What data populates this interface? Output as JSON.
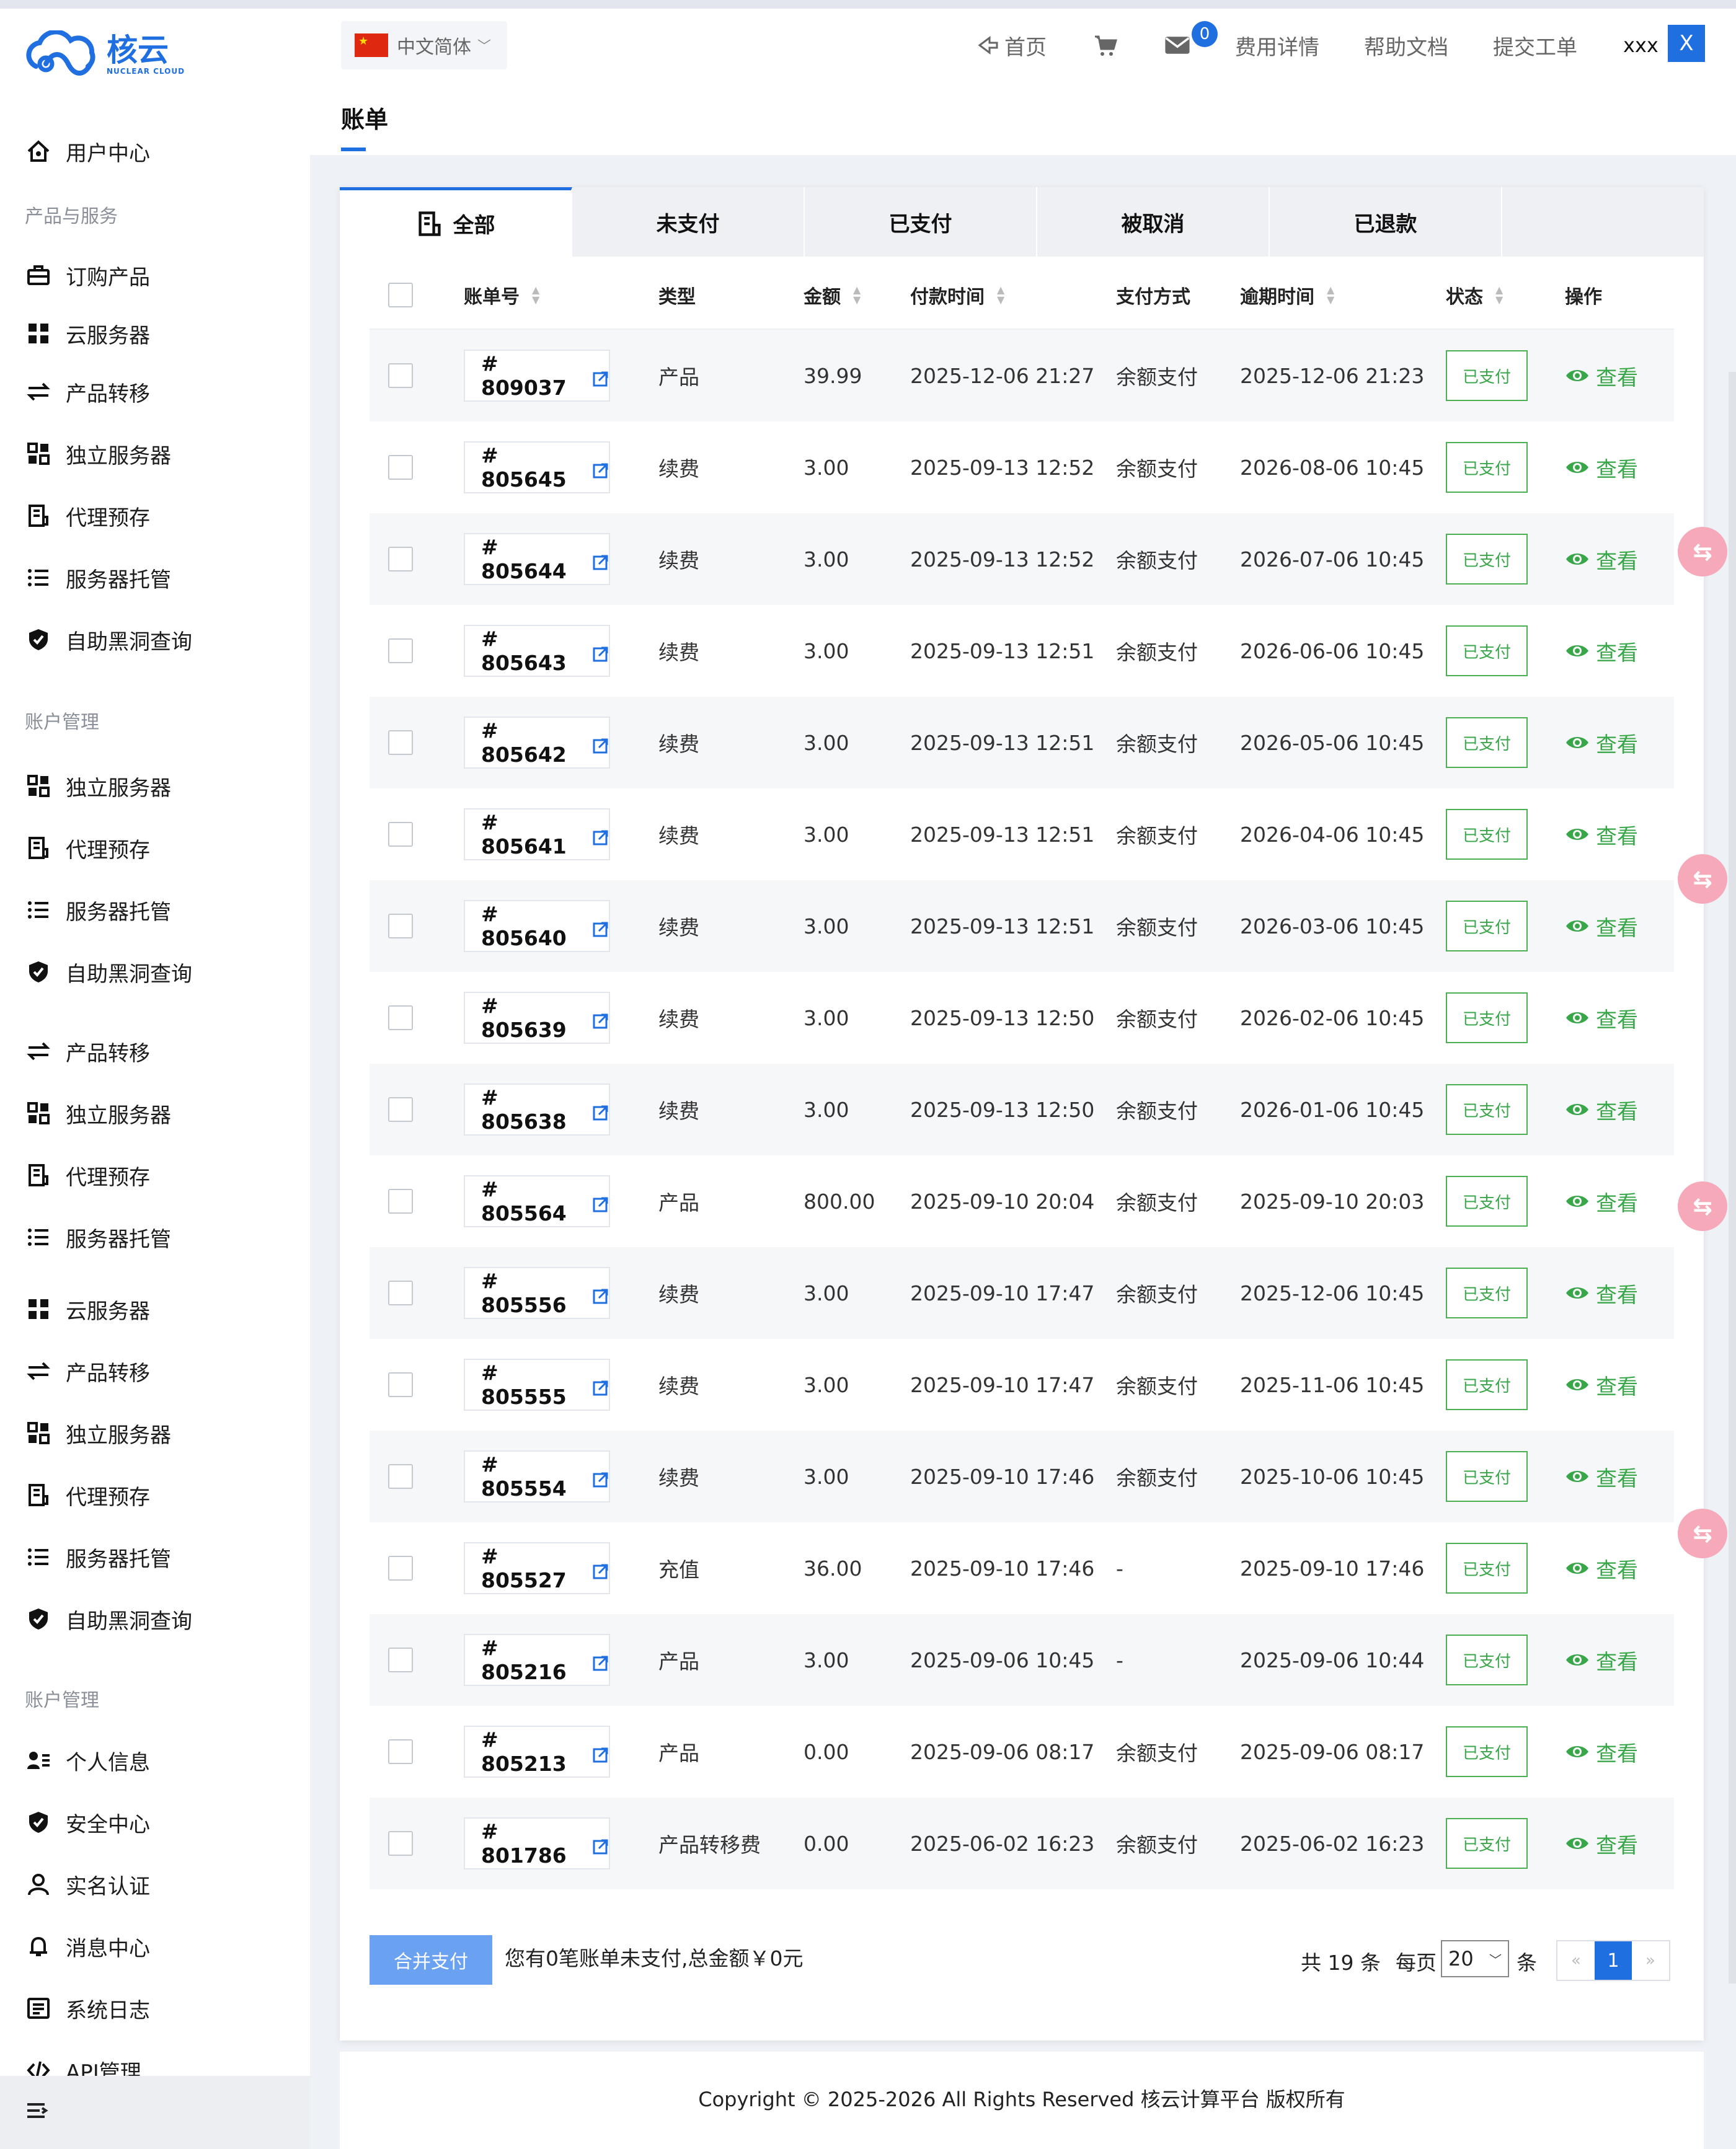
{
  "brand": {
    "name_cn": "核云",
    "name_en": "NUCLEAR CLOUD"
  },
  "header": {
    "language": "中文简体",
    "nav": {
      "home": "首页",
      "billing": "费用详情",
      "docs": "帮助文档",
      "ticket": "提交工单"
    },
    "message_count": "0",
    "username": "xxx",
    "logout_label": "X"
  },
  "sidebar": {
    "items": [
      {
        "label": "用户中心",
        "icon": "home-icon",
        "top": 0
      },
      {
        "section": "产品与服务"
      },
      {
        "label": "订购产品",
        "icon": "briefcase-icon"
      },
      {
        "label": "云服务器",
        "icon": "grid-icon"
      },
      {
        "label": "产品转移",
        "icon": "transfer-icon"
      },
      {
        "label": "独立服务器",
        "icon": "server-grid-icon"
      },
      {
        "label": "代理预存",
        "icon": "document-icon"
      },
      {
        "label": "服务器托管",
        "icon": "list-icon"
      },
      {
        "label": "自助黑洞查询",
        "icon": "shield-icon"
      },
      {
        "section": "账户管理"
      },
      {
        "label": "独立服务器",
        "icon": "server-grid-icon"
      },
      {
        "label": "代理预存",
        "icon": "document-icon"
      },
      {
        "label": "服务器托管",
        "icon": "list-icon"
      },
      {
        "label": "自助黑洞查询",
        "icon": "shield-icon"
      },
      {
        "label": "产品转移",
        "icon": "transfer-icon"
      },
      {
        "label": "独立服务器",
        "icon": "server-grid-icon"
      },
      {
        "label": "代理预存",
        "icon": "document-icon"
      },
      {
        "label": "服务器托管",
        "icon": "list-icon"
      },
      {
        "label": "云服务器",
        "icon": "grid-icon"
      },
      {
        "label": "产品转移",
        "icon": "transfer-icon"
      },
      {
        "label": "独立服务器",
        "icon": "server-grid-icon"
      },
      {
        "label": "代理预存",
        "icon": "document-icon"
      },
      {
        "label": "服务器托管",
        "icon": "list-icon"
      },
      {
        "label": "自助黑洞查询",
        "icon": "shield-icon"
      },
      {
        "section": "账户管理"
      },
      {
        "label": "个人信息",
        "icon": "user-card-icon"
      },
      {
        "label": "安全中心",
        "icon": "shield-icon"
      },
      {
        "label": "实名认证",
        "icon": "user-icon"
      },
      {
        "label": "消息中心",
        "icon": "bell-icon"
      },
      {
        "label": "系统日志",
        "icon": "log-icon"
      },
      {
        "label": "API管理",
        "icon": "code-icon"
      }
    ]
  },
  "page": {
    "title": "账单"
  },
  "tabs": [
    "全部",
    "未支付",
    "已支付",
    "被取消",
    "已退款"
  ],
  "table": {
    "headers": {
      "id": "账单号",
      "type": "类型",
      "amount": "金额",
      "paid_time": "付款时间",
      "method": "支付方式",
      "due_time": "逾期时间",
      "status": "状态",
      "action": "操作"
    },
    "view_label": "查看",
    "rows": [
      {
        "id": "# 809037",
        "type": "产品",
        "amount": "39.99",
        "paid": "2025-12-06 21:27",
        "method": "余额支付",
        "due": "2025-12-06 21:23",
        "status": "已支付"
      },
      {
        "id": "# 805645",
        "type": "续费",
        "amount": "3.00",
        "paid": "2025-09-13 12:52",
        "method": "余额支付",
        "due": "2026-08-06 10:45",
        "status": "已支付"
      },
      {
        "id": "# 805644",
        "type": "续费",
        "amount": "3.00",
        "paid": "2025-09-13 12:52",
        "method": "余额支付",
        "due": "2026-07-06 10:45",
        "status": "已支付"
      },
      {
        "id": "# 805643",
        "type": "续费",
        "amount": "3.00",
        "paid": "2025-09-13 12:51",
        "method": "余额支付",
        "due": "2026-06-06 10:45",
        "status": "已支付"
      },
      {
        "id": "# 805642",
        "type": "续费",
        "amount": "3.00",
        "paid": "2025-09-13 12:51",
        "method": "余额支付",
        "due": "2026-05-06 10:45",
        "status": "已支付"
      },
      {
        "id": "# 805641",
        "type": "续费",
        "amount": "3.00",
        "paid": "2025-09-13 12:51",
        "method": "余额支付",
        "due": "2026-04-06 10:45",
        "status": "已支付"
      },
      {
        "id": "# 805640",
        "type": "续费",
        "amount": "3.00",
        "paid": "2025-09-13 12:51",
        "method": "余额支付",
        "due": "2026-03-06 10:45",
        "status": "已支付"
      },
      {
        "id": "# 805639",
        "type": "续费",
        "amount": "3.00",
        "paid": "2025-09-13 12:50",
        "method": "余额支付",
        "due": "2026-02-06 10:45",
        "status": "已支付"
      },
      {
        "id": "# 805638",
        "type": "续费",
        "amount": "3.00",
        "paid": "2025-09-13 12:50",
        "method": "余额支付",
        "due": "2026-01-06 10:45",
        "status": "已支付"
      },
      {
        "id": "# 805564",
        "type": "产品",
        "amount": "800.00",
        "paid": "2025-09-10 20:04",
        "method": "余额支付",
        "due": "2025-09-10 20:03",
        "status": "已支付"
      },
      {
        "id": "# 805556",
        "type": "续费",
        "amount": "3.00",
        "paid": "2025-09-10 17:47",
        "method": "余额支付",
        "due": "2025-12-06 10:45",
        "status": "已支付"
      },
      {
        "id": "# 805555",
        "type": "续费",
        "amount": "3.00",
        "paid": "2025-09-10 17:47",
        "method": "余额支付",
        "due": "2025-11-06 10:45",
        "status": "已支付"
      },
      {
        "id": "# 805554",
        "type": "续费",
        "amount": "3.00",
        "paid": "2025-09-10 17:46",
        "method": "余额支付",
        "due": "2025-10-06 10:45",
        "status": "已支付"
      },
      {
        "id": "# 805527",
        "type": "充值",
        "amount": "36.00",
        "paid": "2025-09-10 17:46",
        "method": "-",
        "due": "2025-09-10 17:46",
        "status": "已支付"
      },
      {
        "id": "# 805216",
        "type": "产品",
        "amount": "3.00",
        "paid": "2025-09-06 10:45",
        "method": "-",
        "due": "2025-09-06 10:44",
        "status": "已支付"
      },
      {
        "id": "# 805213",
        "type": "产品",
        "amount": "0.00",
        "paid": "2025-09-06 08:17",
        "method": "余额支付",
        "due": "2025-09-06 08:17",
        "status": "已支付"
      },
      {
        "id": "# 801786",
        "type": "产品转移费",
        "amount": "0.00",
        "paid": "2025-06-02 16:23",
        "method": "余额支付",
        "due": "2025-06-02 16:23",
        "status": "已支付"
      }
    ]
  },
  "footer": {
    "merge_label": "合并支付",
    "unpaid_message": "您有0笔账单未支付,总金额￥0元",
    "total_text": "共 19 条",
    "per_page_label": "每页",
    "per_page_value": "20",
    "per_page_unit": "条",
    "prev": "«",
    "current_page": "1",
    "next": "»"
  },
  "copyright": "Copyright © 2025-2026 All Rights Reserved 核云计算平台 版权所有",
  "colors": {
    "primary": "#1f6fe0",
    "success": "#3aa64a"
  }
}
